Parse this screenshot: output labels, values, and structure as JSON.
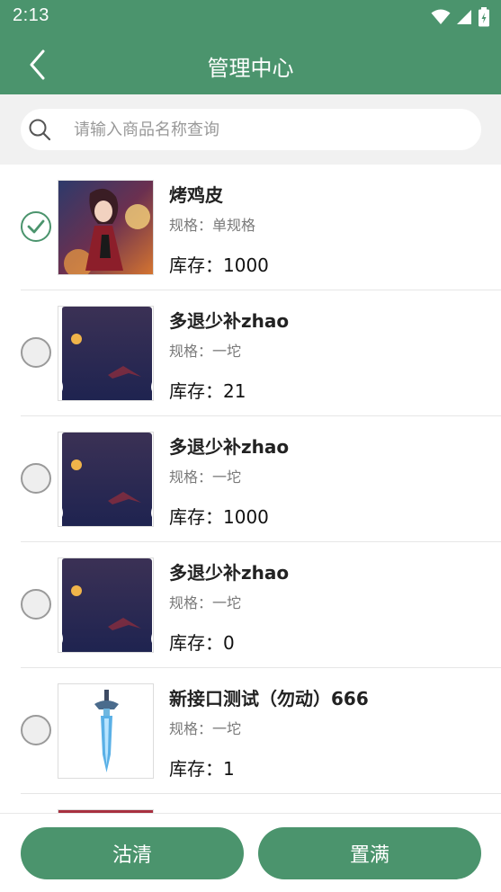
{
  "status": {
    "time": "2:13"
  },
  "header": {
    "title": "管理中心"
  },
  "search": {
    "placeholder": "请输入商品名称查询",
    "value": ""
  },
  "items": [
    {
      "name": "烤鸡皮",
      "spec": "规格：单规格",
      "stock": "库存：1000",
      "checked": true,
      "image": "anime-character-image"
    },
    {
      "name": "多退少补zhao",
      "spec": "规格：一坨",
      "stock": "库存：21",
      "checked": false,
      "image": "night-sky-moon-image"
    },
    {
      "name": "多退少补zhao",
      "spec": "规格：一坨",
      "stock": "库存：1000",
      "checked": false,
      "image": "night-sky-moon-image"
    },
    {
      "name": "多退少补zhao",
      "spec": "规格：一坨",
      "stock": "库存：0",
      "checked": false,
      "image": "night-sky-moon-image"
    },
    {
      "name": "新接口测试（勿动）666",
      "spec": "规格：一坨",
      "stock": "库存：1",
      "checked": false,
      "image": "sword-image"
    }
  ],
  "footer": {
    "clear_label": "沽清",
    "fill_label": "置满"
  },
  "colors": {
    "primary": "#4b946d",
    "background": "#f1f1f1"
  }
}
